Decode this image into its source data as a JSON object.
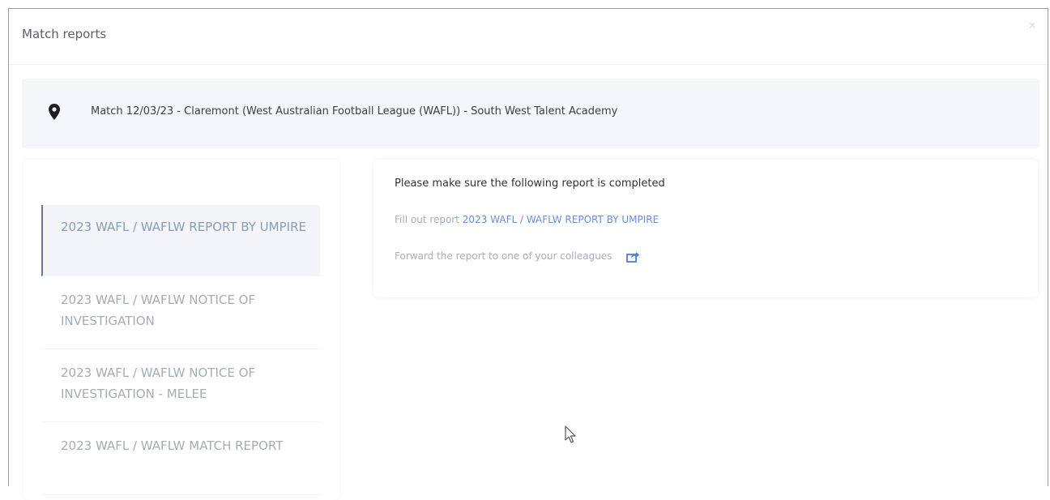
{
  "modal": {
    "title": "Match reports",
    "close_label": "×"
  },
  "match": {
    "icon": "map-pin-icon",
    "text": "Match 12/03/23 - Claremont (West Australian Football League (WAFL)) - South West Talent Academy"
  },
  "reports": [
    {
      "label": "2023 WAFL / WAFLW REPORT BY UMPIRE",
      "active": true
    },
    {
      "label": "2023 WAFL / WAFLW NOTICE OF INVESTIGATION",
      "active": false
    },
    {
      "label": "2023 WAFL / WAFLW NOTICE OF INVESTIGATION - MELEE",
      "active": false
    },
    {
      "label": "2023 WAFL / WAFLW MATCH REPORT",
      "active": false
    }
  ],
  "detail": {
    "heading": "Please make sure the following report is completed",
    "fill_prefix": "Fill out report",
    "fill_link": "2023 WAFL / WAFLW REPORT BY UMPIRE",
    "forward_text": "Forward the report to one of your colleagues",
    "forward_icon": "share-icon"
  },
  "colors": {
    "accent_link": "#6a8fd2",
    "active_border": "#6b7a93",
    "match_bar_bg": "#f4f6fa"
  }
}
